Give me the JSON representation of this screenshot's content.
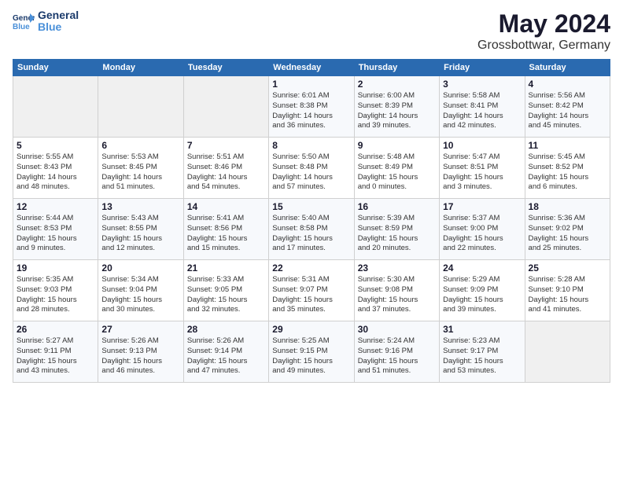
{
  "header": {
    "logo_line1": "General",
    "logo_line2": "Blue",
    "main_title": "May 2024",
    "subtitle": "Grossbottwar, Germany"
  },
  "days_of_week": [
    "Sunday",
    "Monday",
    "Tuesday",
    "Wednesday",
    "Thursday",
    "Friday",
    "Saturday"
  ],
  "weeks": [
    [
      {
        "day": "",
        "info": ""
      },
      {
        "day": "",
        "info": ""
      },
      {
        "day": "",
        "info": ""
      },
      {
        "day": "1",
        "info": "Sunrise: 6:01 AM\nSunset: 8:38 PM\nDaylight: 14 hours\nand 36 minutes."
      },
      {
        "day": "2",
        "info": "Sunrise: 6:00 AM\nSunset: 8:39 PM\nDaylight: 14 hours\nand 39 minutes."
      },
      {
        "day": "3",
        "info": "Sunrise: 5:58 AM\nSunset: 8:41 PM\nDaylight: 14 hours\nand 42 minutes."
      },
      {
        "day": "4",
        "info": "Sunrise: 5:56 AM\nSunset: 8:42 PM\nDaylight: 14 hours\nand 45 minutes."
      }
    ],
    [
      {
        "day": "5",
        "info": "Sunrise: 5:55 AM\nSunset: 8:43 PM\nDaylight: 14 hours\nand 48 minutes."
      },
      {
        "day": "6",
        "info": "Sunrise: 5:53 AM\nSunset: 8:45 PM\nDaylight: 14 hours\nand 51 minutes."
      },
      {
        "day": "7",
        "info": "Sunrise: 5:51 AM\nSunset: 8:46 PM\nDaylight: 14 hours\nand 54 minutes."
      },
      {
        "day": "8",
        "info": "Sunrise: 5:50 AM\nSunset: 8:48 PM\nDaylight: 14 hours\nand 57 minutes."
      },
      {
        "day": "9",
        "info": "Sunrise: 5:48 AM\nSunset: 8:49 PM\nDaylight: 15 hours\nand 0 minutes."
      },
      {
        "day": "10",
        "info": "Sunrise: 5:47 AM\nSunset: 8:51 PM\nDaylight: 15 hours\nand 3 minutes."
      },
      {
        "day": "11",
        "info": "Sunrise: 5:45 AM\nSunset: 8:52 PM\nDaylight: 15 hours\nand 6 minutes."
      }
    ],
    [
      {
        "day": "12",
        "info": "Sunrise: 5:44 AM\nSunset: 8:53 PM\nDaylight: 15 hours\nand 9 minutes."
      },
      {
        "day": "13",
        "info": "Sunrise: 5:43 AM\nSunset: 8:55 PM\nDaylight: 15 hours\nand 12 minutes."
      },
      {
        "day": "14",
        "info": "Sunrise: 5:41 AM\nSunset: 8:56 PM\nDaylight: 15 hours\nand 15 minutes."
      },
      {
        "day": "15",
        "info": "Sunrise: 5:40 AM\nSunset: 8:58 PM\nDaylight: 15 hours\nand 17 minutes."
      },
      {
        "day": "16",
        "info": "Sunrise: 5:39 AM\nSunset: 8:59 PM\nDaylight: 15 hours\nand 20 minutes."
      },
      {
        "day": "17",
        "info": "Sunrise: 5:37 AM\nSunset: 9:00 PM\nDaylight: 15 hours\nand 22 minutes."
      },
      {
        "day": "18",
        "info": "Sunrise: 5:36 AM\nSunset: 9:02 PM\nDaylight: 15 hours\nand 25 minutes."
      }
    ],
    [
      {
        "day": "19",
        "info": "Sunrise: 5:35 AM\nSunset: 9:03 PM\nDaylight: 15 hours\nand 28 minutes."
      },
      {
        "day": "20",
        "info": "Sunrise: 5:34 AM\nSunset: 9:04 PM\nDaylight: 15 hours\nand 30 minutes."
      },
      {
        "day": "21",
        "info": "Sunrise: 5:33 AM\nSunset: 9:05 PM\nDaylight: 15 hours\nand 32 minutes."
      },
      {
        "day": "22",
        "info": "Sunrise: 5:31 AM\nSunset: 9:07 PM\nDaylight: 15 hours\nand 35 minutes."
      },
      {
        "day": "23",
        "info": "Sunrise: 5:30 AM\nSunset: 9:08 PM\nDaylight: 15 hours\nand 37 minutes."
      },
      {
        "day": "24",
        "info": "Sunrise: 5:29 AM\nSunset: 9:09 PM\nDaylight: 15 hours\nand 39 minutes."
      },
      {
        "day": "25",
        "info": "Sunrise: 5:28 AM\nSunset: 9:10 PM\nDaylight: 15 hours\nand 41 minutes."
      }
    ],
    [
      {
        "day": "26",
        "info": "Sunrise: 5:27 AM\nSunset: 9:11 PM\nDaylight: 15 hours\nand 43 minutes."
      },
      {
        "day": "27",
        "info": "Sunrise: 5:26 AM\nSunset: 9:13 PM\nDaylight: 15 hours\nand 46 minutes."
      },
      {
        "day": "28",
        "info": "Sunrise: 5:26 AM\nSunset: 9:14 PM\nDaylight: 15 hours\nand 47 minutes."
      },
      {
        "day": "29",
        "info": "Sunrise: 5:25 AM\nSunset: 9:15 PM\nDaylight: 15 hours\nand 49 minutes."
      },
      {
        "day": "30",
        "info": "Sunrise: 5:24 AM\nSunset: 9:16 PM\nDaylight: 15 hours\nand 51 minutes."
      },
      {
        "day": "31",
        "info": "Sunrise: 5:23 AM\nSunset: 9:17 PM\nDaylight: 15 hours\nand 53 minutes."
      },
      {
        "day": "",
        "info": ""
      }
    ]
  ]
}
